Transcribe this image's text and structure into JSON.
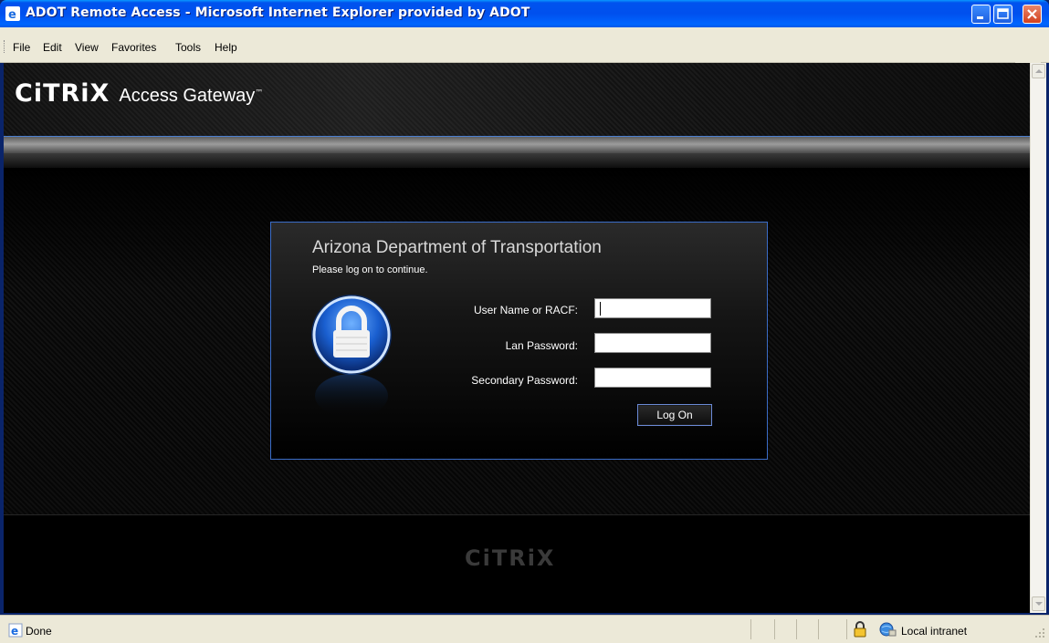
{
  "window": {
    "title": "ADOT Remote Access - Microsoft Internet Explorer provided by ADOT",
    "controls": [
      "minimize-icon",
      "maximize-icon",
      "close-icon"
    ]
  },
  "menubar": {
    "items": [
      "File",
      "Edit",
      "View",
      "Favorites",
      "Tools",
      "Help"
    ]
  },
  "header": {
    "logo": "CiTRiX",
    "product": "Access Gateway",
    "trademark": "™"
  },
  "login": {
    "title": "Arizona Department of Transportation",
    "subtitle": "Please log on to continue.",
    "fields": [
      {
        "label": "User Name or RACF:",
        "value": ""
      },
      {
        "label": "Lan Password:",
        "value": ""
      },
      {
        "label": "Secondary Password:",
        "value": ""
      }
    ],
    "button": "Log On"
  },
  "footer": {
    "logo": "CiTRiX"
  },
  "statusbar": {
    "status": "Done",
    "zone": "Local intranet"
  },
  "colors": {
    "titlebar": "#0054e3",
    "panel_border": "#3a6cc7",
    "background": "#000000"
  }
}
